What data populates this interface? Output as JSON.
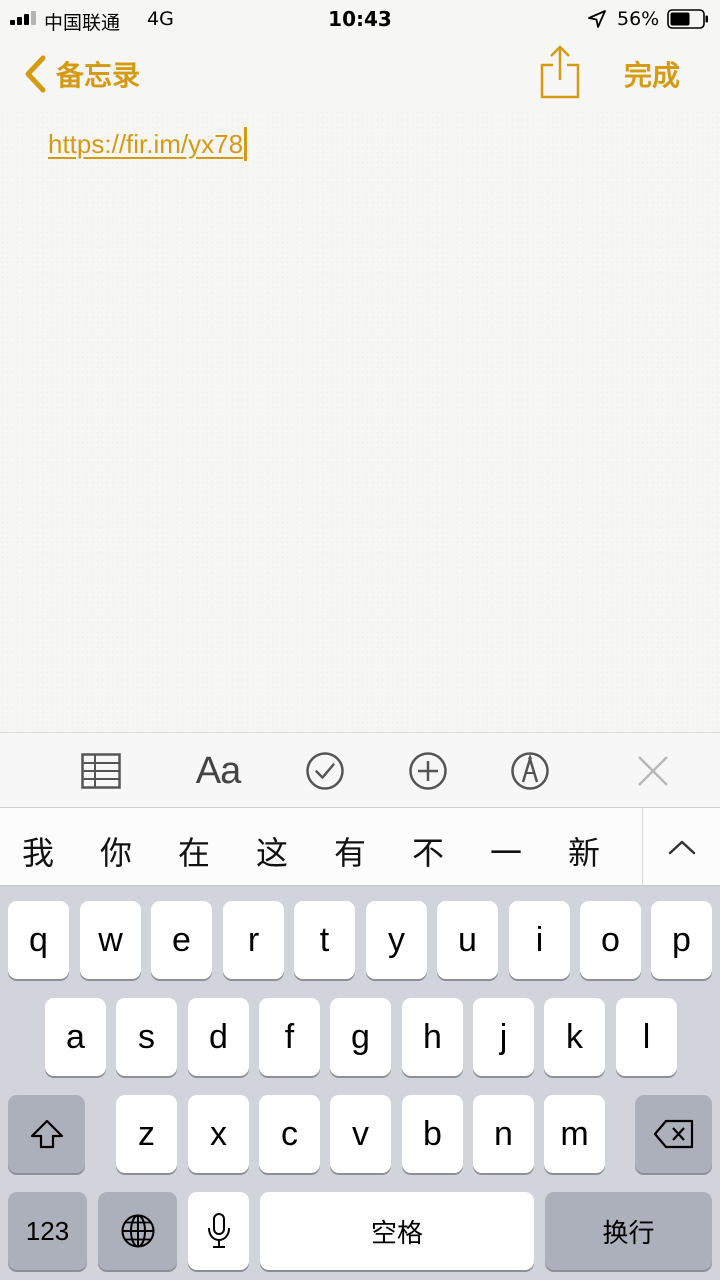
{
  "status_bar": {
    "carrier": "中国联通",
    "network": "4G",
    "time": "10:43",
    "battery_percent": "56%",
    "icons": [
      "signal-icon",
      "location-arrow-icon",
      "battery-icon"
    ]
  },
  "nav": {
    "back_label": "备忘录",
    "done_label": "完成",
    "icons": [
      "chevron-left-icon",
      "share-icon"
    ]
  },
  "note": {
    "link_text": "https://fir.im/yx78"
  },
  "format_toolbar": {
    "items": [
      {
        "name": "table-icon"
      },
      {
        "name": "text-style",
        "label": "Aa"
      },
      {
        "name": "checklist-icon"
      },
      {
        "name": "add-icon"
      },
      {
        "name": "markup-icon"
      },
      {
        "name": "close-icon"
      }
    ]
  },
  "candidates": [
    "我",
    "你",
    "在",
    "这",
    "有",
    "不",
    "一",
    "新"
  ],
  "keyboard": {
    "row1": [
      "q",
      "w",
      "e",
      "r",
      "t",
      "y",
      "u",
      "i",
      "o",
      "p"
    ],
    "row2": [
      "a",
      "s",
      "d",
      "f",
      "g",
      "h",
      "j",
      "k",
      "l"
    ],
    "row3": [
      "z",
      "x",
      "c",
      "v",
      "b",
      "n",
      "m"
    ],
    "numbers_label": "123",
    "space_label": "空格",
    "return_label": "换行"
  },
  "colors": {
    "accent": "#d49a12",
    "keyboard_bg": "#d1d4da",
    "key": "#ffffff",
    "key_dark": "#abb0bb"
  }
}
